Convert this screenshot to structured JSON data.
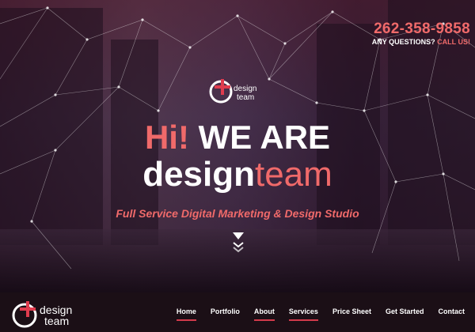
{
  "header": {
    "phone": "262-358-9858",
    "questions_label": "ANY QUESTIONS?",
    "call_label": "CALL US!"
  },
  "logo": {
    "word1": "design",
    "word2": "team"
  },
  "hero": {
    "hi": "Hi!",
    "we_are": "WE ARE",
    "brand_bold": "design",
    "brand_light": "team",
    "tagline": "Full Service Digital Marketing & Design Studio",
    "scroll_icon": "double-chevron-down-icon"
  },
  "nav": {
    "items": [
      {
        "label": "Home",
        "active": true
      },
      {
        "label": "Portfolio",
        "active": false
      },
      {
        "label": "About",
        "active": true
      },
      {
        "label": "Services",
        "active": true
      },
      {
        "label": "Price Sheet",
        "active": false
      },
      {
        "label": "Get Started",
        "active": false
      },
      {
        "label": "Contact",
        "active": false
      }
    ]
  },
  "colors": {
    "accent": "#f06a6a",
    "underline": "#d23a4c",
    "navbar_bg": "#1b0f16"
  }
}
